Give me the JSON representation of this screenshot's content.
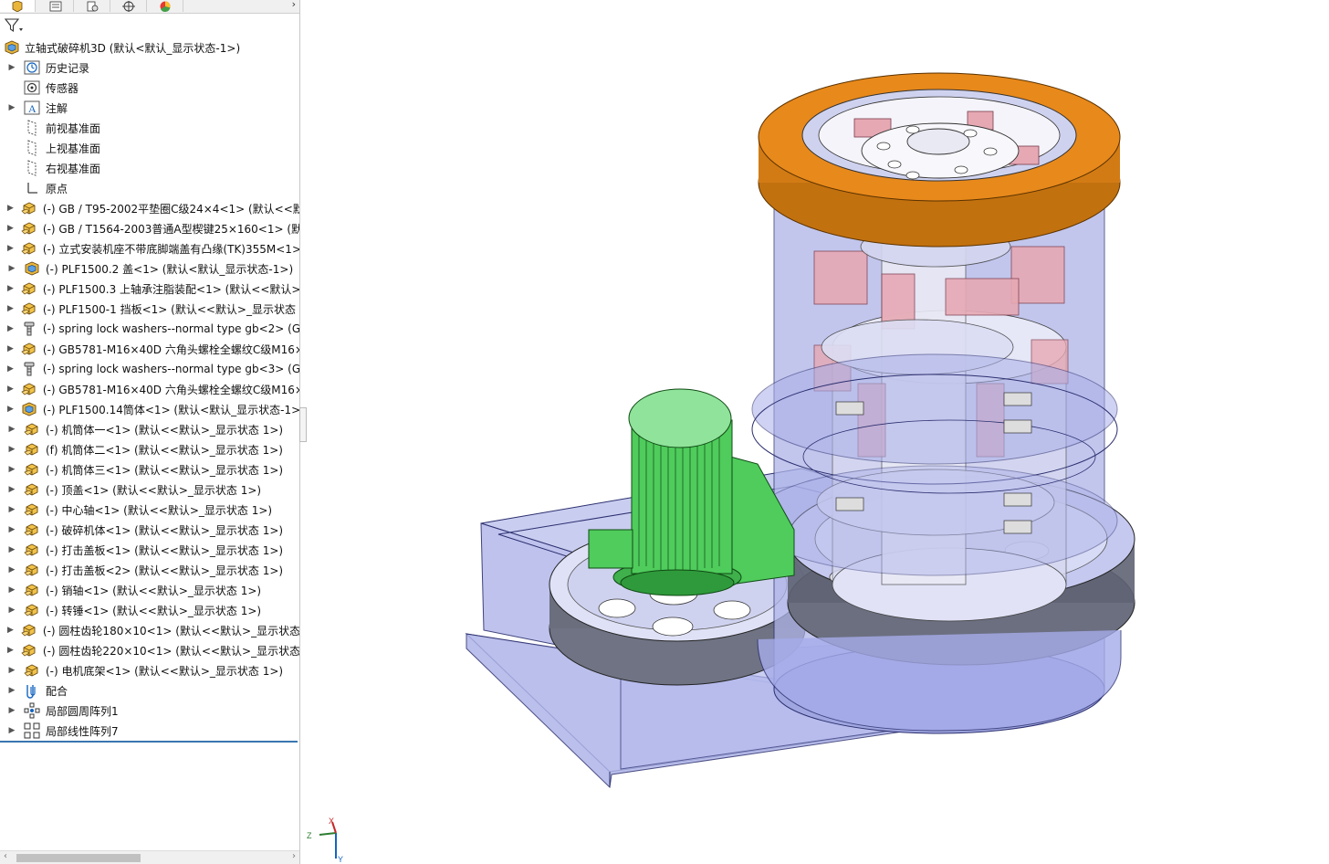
{
  "feature_tree": {
    "root_label": "立轴式破碎机3D (默认<默认_显示状态-1>)",
    "items": [
      {
        "label": "历史记录",
        "icon": "history-icon",
        "expandable": true
      },
      {
        "label": "传感器",
        "icon": "sensor-icon",
        "expandable": false
      },
      {
        "label": "注解",
        "icon": "annotation-icon",
        "expandable": true
      },
      {
        "label": "前视基准面",
        "icon": "plane-icon",
        "expandable": false
      },
      {
        "label": "上视基准面",
        "icon": "plane-icon",
        "expandable": false
      },
      {
        "label": "右视基准面",
        "icon": "plane-icon",
        "expandable": false
      },
      {
        "label": "原点",
        "icon": "origin-icon",
        "expandable": false
      },
      {
        "label": "(-) GB / T95-2002平垫圈C级24×4<1> (默认<<默认",
        "icon": "part-icon",
        "expandable": true
      },
      {
        "label": "(-) GB / T1564-2003普通A型楔键25×160<1> (默认",
        "icon": "part-icon",
        "expandable": true
      },
      {
        "label": "(-) 立式安装机座不带底脚端盖有凸缘(TK)355M<1>",
        "icon": "part-icon",
        "expandable": true
      },
      {
        "label": "(-) PLF1500.2 盖<1> (默认<默认_显示状态-1>)",
        "icon": "assembly-icon",
        "expandable": true
      },
      {
        "label": "(-) PLF1500.3 上轴承注脂装配<1> (默认<<默认>_",
        "icon": "part-icon",
        "expandable": true
      },
      {
        "label": "(-) PLF1500-1 挡板<1> (默认<<默认>_显示状态 1",
        "icon": "part-icon",
        "expandable": true
      },
      {
        "label": "(-) spring lock washers--normal type gb<2> (G",
        "icon": "toolbox-icon",
        "expandable": true
      },
      {
        "label": "(-) GB5781-M16×40D 六角头螺栓全螺纹C级M16×",
        "icon": "part-icon",
        "expandable": true
      },
      {
        "label": "(-) spring lock washers--normal type gb<3> (G",
        "icon": "toolbox-icon",
        "expandable": true
      },
      {
        "label": "(-) GB5781-M16×40D 六角头螺栓全螺纹C级M16×",
        "icon": "part-icon",
        "expandable": true
      },
      {
        "label": "(-) PLF1500.14筒体<1> (默认<默认_显示状态-1>)",
        "icon": "assembly-icon",
        "expandable": true
      },
      {
        "label": "(-) 机筒体一<1> (默认<<默认>_显示状态 1>)",
        "icon": "part-icon",
        "expandable": true
      },
      {
        "label": "(f) 机筒体二<1> (默认<<默认>_显示状态 1>)",
        "icon": "part-icon",
        "expandable": true
      },
      {
        "label": "(-) 机筒体三<1> (默认<<默认>_显示状态 1>)",
        "icon": "part-icon",
        "expandable": true
      },
      {
        "label": "(-) 顶盖<1> (默认<<默认>_显示状态 1>)",
        "icon": "part-icon",
        "expandable": true
      },
      {
        "label": "(-) 中心轴<1> (默认<<默认>_显示状态 1>)",
        "icon": "part-icon",
        "expandable": true
      },
      {
        "label": "(-) 破碎机体<1> (默认<<默认>_显示状态 1>)",
        "icon": "part-icon",
        "expandable": true
      },
      {
        "label": "(-) 打击盖板<1> (默认<<默认>_显示状态 1>)",
        "icon": "part-icon",
        "expandable": true
      },
      {
        "label": "(-) 打击盖板<2> (默认<<默认>_显示状态 1>)",
        "icon": "part-icon",
        "expandable": true
      },
      {
        "label": "(-) 销轴<1> (默认<<默认>_显示状态 1>)",
        "icon": "part-icon",
        "expandable": true
      },
      {
        "label": "(-) 转锤<1> (默认<<默认>_显示状态 1>)",
        "icon": "part-icon",
        "expandable": true
      },
      {
        "label": "(-) 圆柱齿轮180×10<1> (默认<<默认>_显示状态 1",
        "icon": "part-icon",
        "expandable": true
      },
      {
        "label": "(-) 圆柱齿轮220×10<1> (默认<<默认>_显示状态 1",
        "icon": "part-icon",
        "expandable": true
      },
      {
        "label": "(-) 电机底架<1> (默认<<默认>_显示状态 1>)",
        "icon": "part-icon",
        "expandable": true
      },
      {
        "label": "配合",
        "icon": "mates-icon",
        "expandable": true
      },
      {
        "label": "局部圆周阵列1",
        "icon": "circular-pattern-icon",
        "expandable": true
      },
      {
        "label": "局部线性阵列7",
        "icon": "linear-pattern-icon",
        "expandable": true
      }
    ]
  },
  "tabs": [
    {
      "name": "featuremanager-tab",
      "icon": "featuremanager-icon"
    },
    {
      "name": "propertymanager-tab",
      "icon": "propertymanager-icon"
    },
    {
      "name": "configurationmanager-tab",
      "icon": "configuration-icon"
    },
    {
      "name": "dimxpert-tab",
      "icon": "dimxpert-icon"
    },
    {
      "name": "display-manager-tab",
      "icon": "appearance-icon"
    }
  ],
  "triad": {
    "x": "X",
    "y": "Y",
    "z": "Z"
  },
  "colors": {
    "accent_blue": "#3a76b0",
    "casing_blue": "#aeb4e8",
    "flange_orange": "#e8891b",
    "motor_green": "#4fcc5c",
    "hammer_pink": "#e6a9b4"
  }
}
